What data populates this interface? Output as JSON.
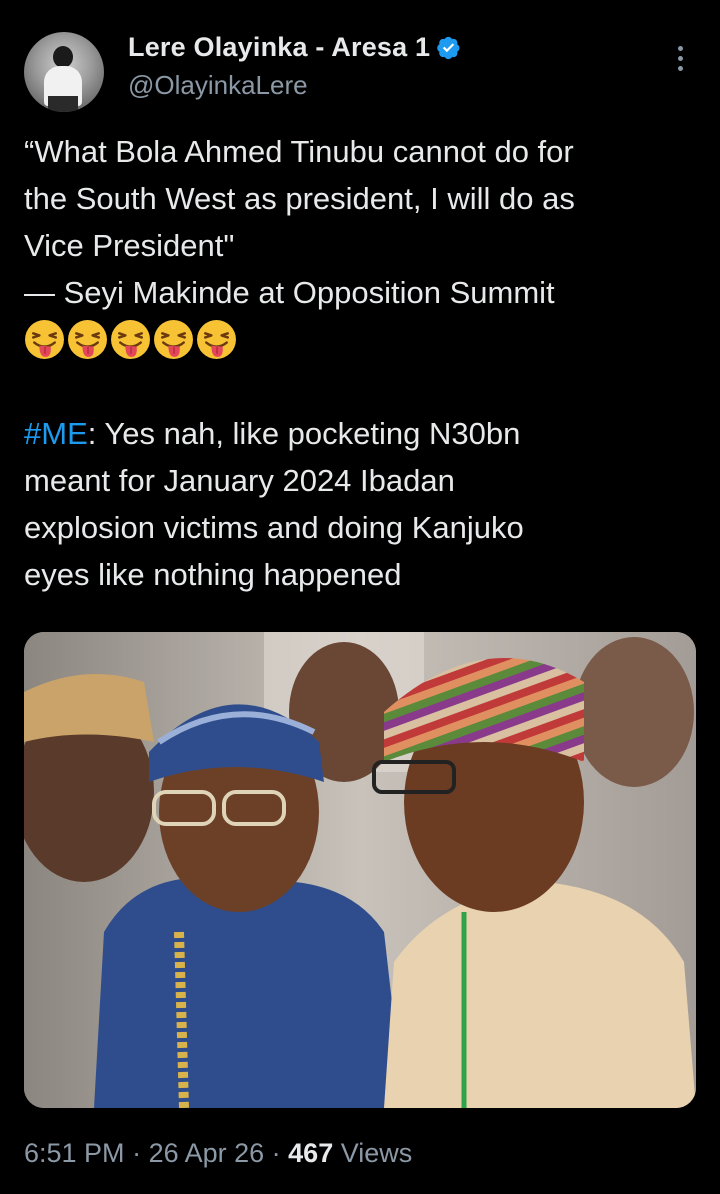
{
  "author": {
    "name": "Lere Olayinka - Aresa 1",
    "handle": "@OlayinkaLere",
    "verified_color": "#1d9bf0"
  },
  "tweet": {
    "line1": "“What Bola Ahmed Tinubu cannot do for",
    "line2": "the South West as president, I will do as",
    "line3": "Vice President\"",
    "line4": "— Seyi Makinde at Opposition Summit",
    "emoji_count": 5,
    "emoji_name": "winking-face-with-tongue-icon",
    "hashtag": "#ME",
    "reply_line1": ": Yes nah, like pocketing N30bn",
    "reply_line2": "meant for January 2024 Ibadan",
    "reply_line3": "explosion victims and doing Kanjuko",
    "reply_line4": "eyes like nothing happened"
  },
  "meta": {
    "time": "6:51 PM",
    "sep1": " · ",
    "date": "26 Apr 26",
    "sep2": " · ",
    "views_count": "467",
    "views_label": " Views"
  },
  "colors": {
    "background": "#000000",
    "text": "#e7e9ea",
    "muted": "#8b98a5",
    "accent": "#1d9bf0"
  }
}
